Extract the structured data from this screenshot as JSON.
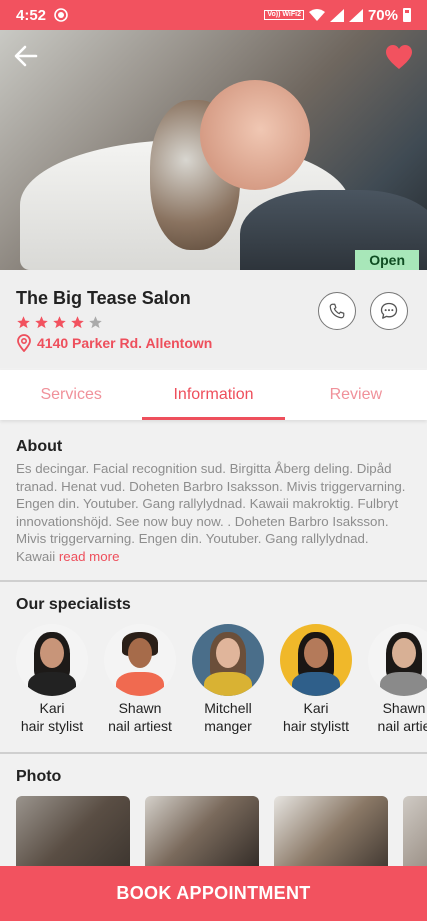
{
  "status_bar": {
    "time": "4:52",
    "network_label": "Vo)) WiFi2",
    "battery": "70%"
  },
  "hero": {
    "open_badge": "Open"
  },
  "salon": {
    "name": "The Big Tease Salon",
    "rating": 4,
    "rating_max": 5,
    "address": "4140 Parker Rd. Allentown"
  },
  "tabs": [
    {
      "label": "Services",
      "active": false
    },
    {
      "label": "Information",
      "active": true
    },
    {
      "label": "Review",
      "active": false
    }
  ],
  "about": {
    "title": "About",
    "text": "Es decingar. Facial recognition sud. Birgitta Åberg deling. Dipåd tranad. Henat vud. Doheten Barbro Isaksson. Mivis triggervarning. Engen din. Youtuber. Gang rallylydnad. Kawaii makroktig. Fulbryt innovationshöjd. See now buy now. . Doheten Barbro Isaksson. Mivis triggervarning. Engen din. Youtuber. Gang rallylydnad. Kawaii",
    "read_more": "read more"
  },
  "specialists": {
    "title": "Our specialists",
    "items": [
      {
        "name": "Kari",
        "role": "hair stylist"
      },
      {
        "name": "Shawn",
        "role": "nail artiest"
      },
      {
        "name": "Mitchell",
        "role": "manger"
      },
      {
        "name": "Kari",
        "role": "hair stylistt"
      },
      {
        "name": "Shawn",
        "role": "nail artie"
      }
    ]
  },
  "photo": {
    "title": "Photo"
  },
  "book_button": "BOOK APPOINTMENT",
  "colors": {
    "accent": "#f2525f",
    "open_bg": "#a8e7b9",
    "star_filled": "#f2525f",
    "star_empty": "#aaaaaa"
  },
  "icons": {
    "back": "arrow-left-icon",
    "favorite": "heart-icon",
    "call": "phone-icon",
    "chat": "chat-icon",
    "location": "location-pin-icon",
    "star": "star-icon"
  }
}
